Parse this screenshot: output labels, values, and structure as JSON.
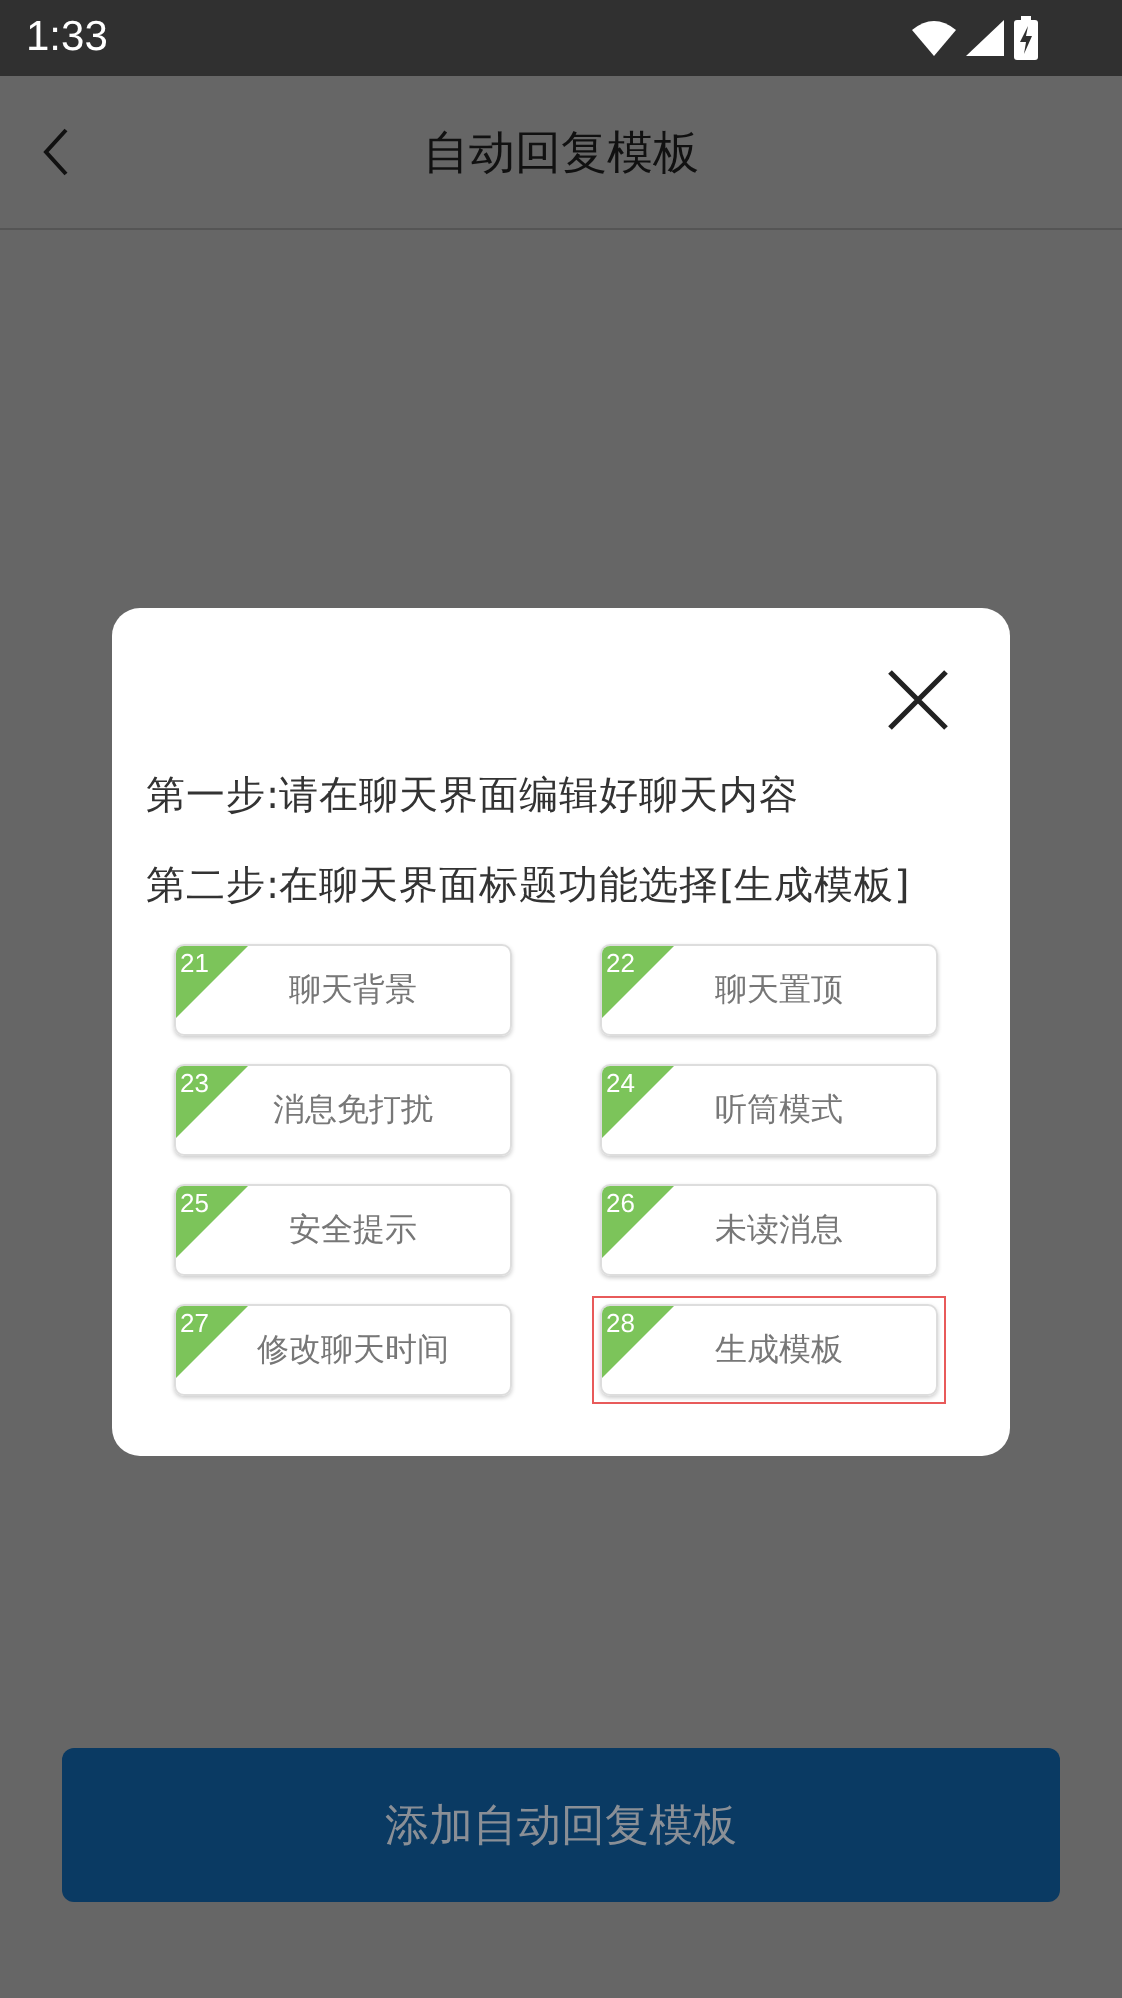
{
  "status_bar": {
    "time": "1:33"
  },
  "header": {
    "title": "自动回复模板"
  },
  "dialog": {
    "steps": [
      "第一步:请在聊天界面编辑好聊天内容",
      "第二步:在聊天界面标题功能选择[生成模板]"
    ],
    "options": [
      {
        "number": "21",
        "label": "聊天背景",
        "selected": false
      },
      {
        "number": "22",
        "label": "聊天置顶",
        "selected": false
      },
      {
        "number": "23",
        "label": "消息免打扰",
        "selected": false
      },
      {
        "number": "24",
        "label": "听筒模式",
        "selected": false
      },
      {
        "number": "25",
        "label": "安全提示",
        "selected": false
      },
      {
        "number": "26",
        "label": "未读消息",
        "selected": false
      },
      {
        "number": "27",
        "label": "修改聊天时间",
        "selected": false
      },
      {
        "number": "28",
        "label": "生成模板",
        "selected": true
      }
    ]
  },
  "add_button": {
    "label": "添加自动回复模板"
  }
}
